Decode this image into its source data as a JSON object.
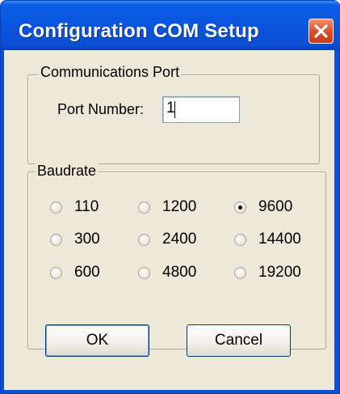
{
  "window": {
    "title": "Configuration COM Setup"
  },
  "comm_group": {
    "legend": "Communications Port",
    "port_label": "Port Number:",
    "port_value": "1"
  },
  "baud_group": {
    "legend": "Baudrate",
    "options": [
      {
        "label": "110",
        "checked": false
      },
      {
        "label": "1200",
        "checked": false
      },
      {
        "label": "9600",
        "checked": true
      },
      {
        "label": "300",
        "checked": false
      },
      {
        "label": "2400",
        "checked": false
      },
      {
        "label": "14400",
        "checked": false
      },
      {
        "label": "600",
        "checked": false
      },
      {
        "label": "4800",
        "checked": false
      },
      {
        "label": "19200",
        "checked": false
      }
    ]
  },
  "buttons": {
    "ok": "OK",
    "cancel": "Cancel"
  },
  "colors": {
    "titlebar": "#0a55dd",
    "close_button": "#dc4a25",
    "dialog_face": "#ece9d8"
  },
  "icons": {
    "close": "close-x-icon",
    "radio_selected": "radio-selected-icon",
    "radio_unselected": "radio-unselected-icon"
  }
}
